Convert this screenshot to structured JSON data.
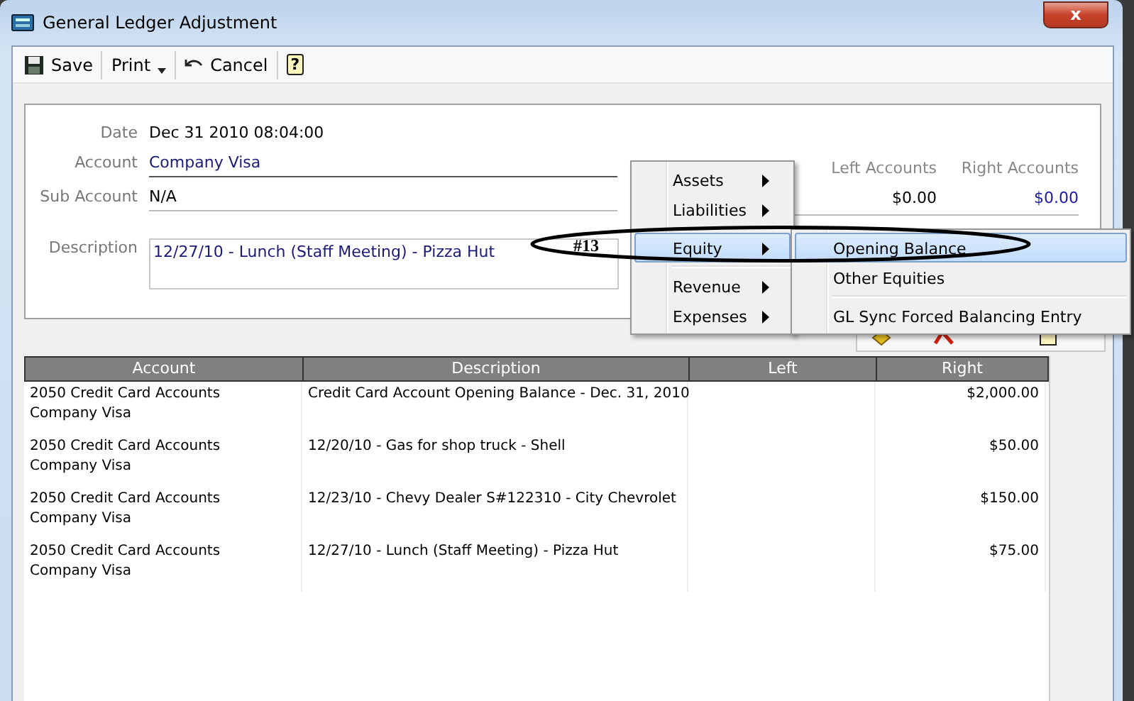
{
  "window": {
    "title": "General Ledger Adjustment",
    "close_label": "x"
  },
  "toolbar": [
    {
      "kind": "save",
      "label": "Save"
    },
    {
      "kind": "print",
      "label": "Print"
    },
    {
      "kind": "cancel",
      "label": "Cancel"
    },
    {
      "kind": "help",
      "label": "?"
    }
  ],
  "form": {
    "fields": [
      {
        "kind": "plain",
        "label": "Date",
        "value": "Dec 31 2010 08:04:00"
      },
      {
        "kind": "line",
        "label": "Account",
        "value": "Company Visa"
      },
      {
        "kind": "line",
        "label": "Sub Account",
        "value": "N/A"
      },
      {
        "kind": "multiline",
        "label": "Description",
        "value": "12/27/10 - Lunch (Staff Meeting) - Pizza Hut"
      }
    ],
    "summary": {
      "columns": [
        "Left Accounts",
        "Right Accounts"
      ],
      "values": [
        "$0.00",
        "$0.00"
      ]
    }
  },
  "table": {
    "columns": [
      "Account",
      "Description",
      "Left",
      "Right"
    ],
    "rows": [
      {
        "account": [
          "2050 Credit Card Accounts",
          "Company Visa"
        ],
        "description": "Credit Card Account Opening Balance - Dec. 31, 2010",
        "left": "",
        "right": "$2,000.00"
      },
      {
        "account": [
          "2050 Credit Card Accounts",
          "Company Visa"
        ],
        "description": "12/20/10 - Gas for shop truck - Shell",
        "left": "",
        "right": "$50.00"
      },
      {
        "account": [
          "2050 Credit Card Accounts",
          "Company Visa"
        ],
        "description": "12/23/10 - Chevy Dealer S#122310 - City Chevrolet",
        "left": "",
        "right": "$150.00"
      },
      {
        "account": [
          "2050 Credit Card Accounts",
          "Company Visa"
        ],
        "description": "12/27/10 - Lunch (Staff Meeting) - Pizza Hut",
        "left": "",
        "right": "$75.00"
      }
    ]
  },
  "context_menu": [
    {
      "label": "Assets",
      "selected": false,
      "separator_after": false
    },
    {
      "label": "Liabilities",
      "selected": false,
      "separator_after": true
    },
    {
      "label": "Equity",
      "selected": true,
      "separator_after": true
    },
    {
      "label": "Revenue",
      "selected": false,
      "separator_after": false
    },
    {
      "label": "Expenses",
      "selected": false,
      "separator_after": false
    }
  ],
  "submenu": [
    {
      "label": "Opening Balance",
      "selected": true,
      "separator_after": false
    },
    {
      "label": "Other Equities",
      "selected": false,
      "separator_after": true
    },
    {
      "label": "GL Sync Forced Balancing Entry",
      "selected": false,
      "separator_after": false
    }
  ],
  "annotation": {
    "label": "#13"
  }
}
